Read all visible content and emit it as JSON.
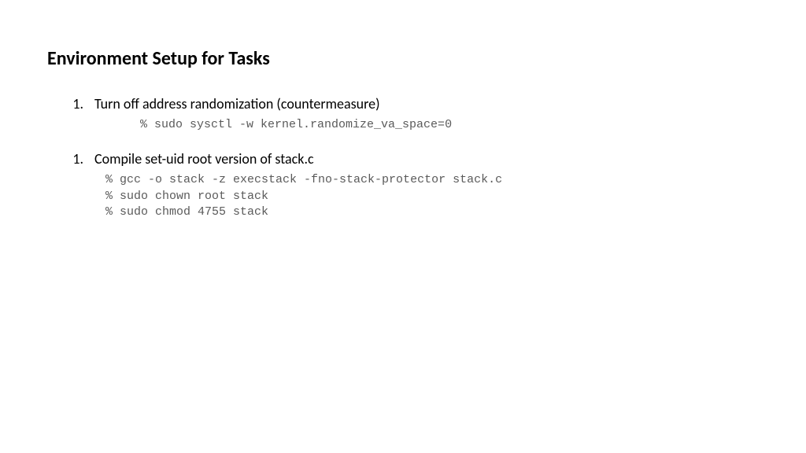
{
  "title": "Environment Setup for Tasks",
  "items": [
    {
      "number": "1.",
      "text": "Turn off address randomization (countermeasure)",
      "code": [
        "% sudo sysctl -w kernel.randomize_va_space=0"
      ],
      "indented": true
    },
    {
      "number": "1.",
      "text": "Compile set-uid root version of stack.c",
      "code": [
        "% gcc -o stack -z execstack -fno-stack-protector stack.c",
        "% sudo chown root stack",
        "% sudo chmod 4755 stack"
      ],
      "indented": false
    }
  ]
}
